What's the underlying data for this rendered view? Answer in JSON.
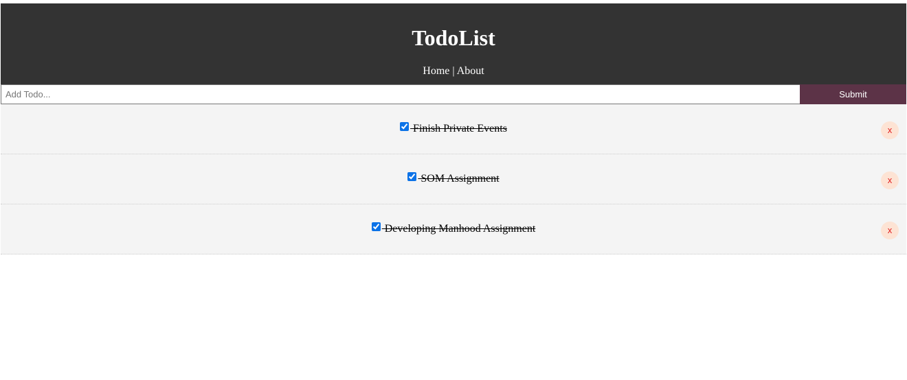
{
  "header": {
    "title": "TodoList",
    "nav": {
      "home": "Home",
      "separator": "|",
      "about": "About"
    }
  },
  "form": {
    "placeholder": "Add Todo...",
    "value": "",
    "submit_label": "Submit"
  },
  "todos": [
    {
      "text": " Finish Private Events",
      "completed": true,
      "delete_label": "x"
    },
    {
      "text": " SOM Assignment",
      "completed": true,
      "delete_label": "x"
    },
    {
      "text": " Developing Manhood Assignment",
      "completed": true,
      "delete_label": "x"
    }
  ],
  "colors": {
    "header_bg": "#333333",
    "submit_bg": "#5c3347",
    "item_bg": "#f4f4f4",
    "delete_bg": "#fde3d4",
    "delete_fg": "#e02020"
  }
}
